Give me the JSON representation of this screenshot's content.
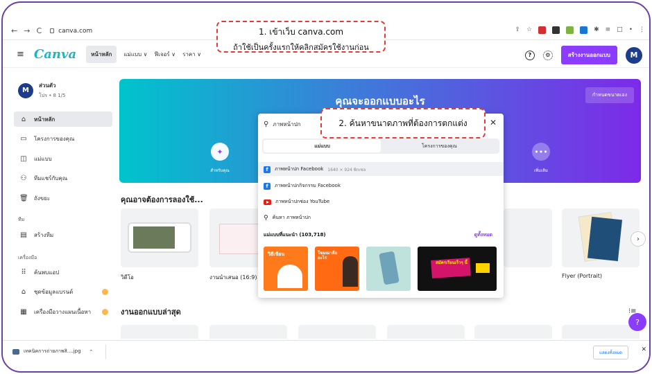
{
  "browser": {
    "url": "canva.com",
    "back": "←",
    "forward": "→",
    "reload": "C"
  },
  "header": {
    "logo": "Canva",
    "menu": [
      "หน้าหลัก",
      "แม่แบบ ∨",
      "ฟีเจอร์ ∨",
      "ราคา ∨"
    ],
    "create_button": "สร้างงานออกแบบ",
    "avatar_letter": "M"
  },
  "sidebar": {
    "profile_name": "ส่วนตัว",
    "profile_sub": "โปร • 8 1/5",
    "avatar_letter": "M",
    "items": [
      "หน้าหลัก",
      "โครงการของคุณ",
      "แม่แบบ",
      "ทีมแชร์กับคุณ",
      "ถังขยะ"
    ],
    "team_label": "ทีม",
    "team_items": [
      "สร้างทีม"
    ],
    "tools_label": "เครื่องมือ",
    "tool_items": [
      "ค้นพบแอป",
      "ชุดข้อมูลแบรนด์",
      "เครื่องมือวางแผนเนื้อหา"
    ]
  },
  "hero": {
    "title": "คุณจะออกแบบอะไร",
    "custom_size_button": "กำหนดขนาดเอง",
    "left_label": "สำหรับคุณ",
    "right_label": "เพิ่มเติม"
  },
  "sections": {
    "try": "คุณอาจต้องการลองใช้...",
    "recent": "งานออกแบบล่าสุด"
  },
  "cards": [
    "วิดีโอ",
    "งานนำเสนอ (16:9)",
    "Flyer (Portrait)"
  ],
  "popup": {
    "query": "ภาพหน้าปก",
    "tabs": [
      "แม่แบบ",
      "โครงการของคุณ"
    ],
    "suggestions": [
      {
        "text": "ภาพหน้าปก Facebook",
        "extra": "1640 × 924 พิกเซล",
        "icon": "facebook-icon"
      },
      {
        "text": "ภาพหน้าปกกิจกรรม Facebook",
        "extra": "",
        "icon": "facebook-icon"
      },
      {
        "text": "ภาพหน้าปกช่อง YouTube",
        "extra": "",
        "icon": "youtube-icon"
      },
      {
        "text": "ค้นหา ภาพหน้าปก",
        "extra": "",
        "icon": "search-icon"
      }
    ],
    "recommended_label": "แม่แบบที่แนะนำ (103,718)",
    "see_all": "ดูทั้งหมด",
    "thumb_texts": [
      "วิธีเขียน",
      "โฆษณาคืออะไร",
      "",
      "สมัครเรียนเร็วๆ นี้"
    ]
  },
  "callouts": {
    "one_line1": "1. เข้าเว็บ canva.com",
    "one_line2": "ถ้าใช้เป็นครั้งแรกให้คลิกสมัครใช้งานก่อน",
    "two": "2. ค้นหาขนาดภาพที่ต้องการตกแต่ง"
  },
  "download_bar": {
    "file": "เทคนิคการถ่ายภาพสิ....jpg",
    "show_all": "แสดงทั้งหมด",
    "close": "✕"
  }
}
